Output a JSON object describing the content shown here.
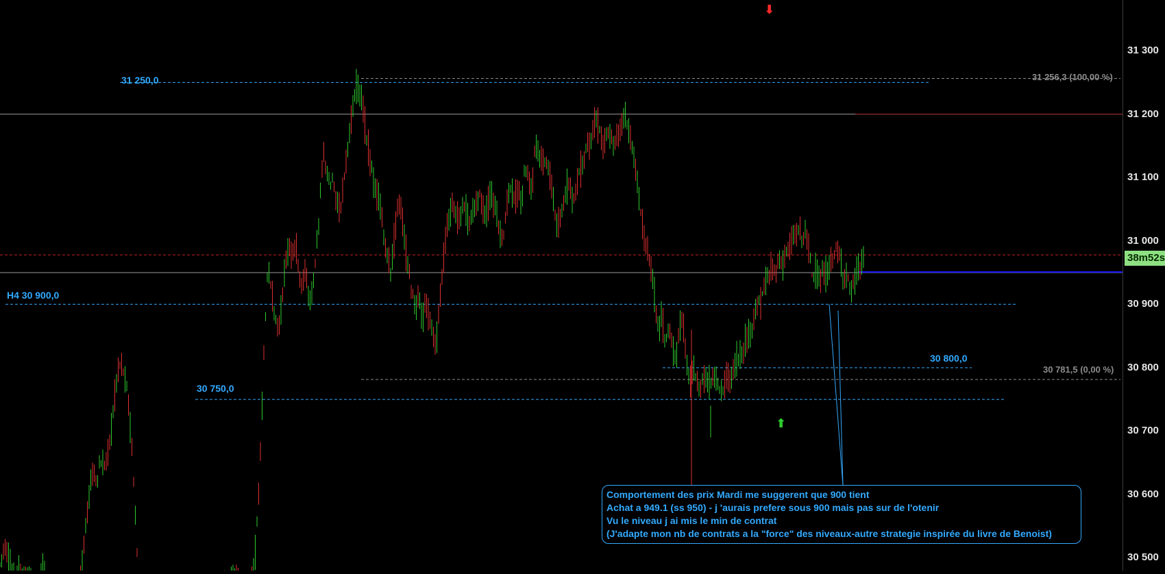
{
  "chart_data": {
    "type": "candlestick",
    "ylim": [
      30480,
      31380
    ],
    "ticks": [
      {
        "value": 31300,
        "label": "31 300"
      },
      {
        "value": 31200,
        "label": "31 200"
      },
      {
        "value": 31100,
        "label": "31 100"
      },
      {
        "value": 31000,
        "label": "31 000"
      },
      {
        "value": 30900,
        "label": "30 900"
      },
      {
        "value": 30800,
        "label": "30 800"
      },
      {
        "value": 30700,
        "label": "30 700"
      },
      {
        "value": 30600,
        "label": "30 600"
      },
      {
        "value": 30500,
        "label": "30 500"
      }
    ],
    "levels": [
      {
        "price": 31250.0,
        "label": "31 250,0"
      },
      {
        "price": 30900.0,
        "label": "H4 30 900,0"
      },
      {
        "price": 30800.0,
        "label": "30 800,0"
      },
      {
        "price": 30750.0,
        "label": "30 750,0"
      }
    ],
    "fibonacci": [
      {
        "price": 31256.3,
        "label": "31 256,3 (100,00 %)"
      },
      {
        "price": 30781.5,
        "label": "30 781,5 (0,00 %)"
      }
    ],
    "horizontal_lines": [
      31200,
      30950
    ],
    "current_price_line": 30978,
    "entry_line": 30951,
    "timer": "38m52s",
    "annotation": [
      "Comportement des prix Mardi me suggerent que 900 tient",
      "Achat a 949.1 (ss 950) - j 'aurais prefere sous 900 mais pas sur de l'otenir",
      "Vu le niveau j ai mis le min de contrat",
      "(J'adapte mon nb de contrats a la \"force\" des niveaux-autre strategie inspirée du livre de Benoist)"
    ],
    "colors": {
      "up": "#2ecc2e",
      "down": "#e03030",
      "level": "#33aaff",
      "fib": "#8c8c8c",
      "current": "#cc2222",
      "entry": "#1a1aff",
      "hline": "#9a9a9a",
      "background": "#000000"
    },
    "path": [
      [
        0,
        30490
      ],
      [
        6,
        30520
      ],
      [
        12,
        30505
      ],
      [
        16,
        30480
      ],
      [
        22,
        30465
      ],
      [
        26,
        30490
      ],
      [
        31,
        30470
      ],
      [
        36,
        30460
      ],
      [
        41,
        30475
      ],
      [
        46,
        30455
      ],
      [
        51,
        30445
      ],
      [
        56,
        30460
      ],
      [
        61,
        30480
      ],
      [
        66,
        30470
      ],
      [
        71,
        30440
      ],
      [
        76,
        30420
      ],
      [
        81,
        30400
      ],
      [
        86,
        30380
      ],
      [
        91,
        30390
      ],
      [
        96,
        30370
      ],
      [
        101,
        30380
      ],
      [
        106,
        30400
      ],
      [
        111,
        30420
      ],
      [
        116,
        30460
      ],
      [
        121,
        30500
      ],
      [
        126,
        30560
      ],
      [
        131,
        30610
      ],
      [
        136,
        30640
      ],
      [
        141,
        30620
      ],
      [
        146,
        30650
      ],
      [
        151,
        30640
      ],
      [
        156,
        30660
      ],
      [
        161,
        30690
      ],
      [
        166,
        30740
      ],
      [
        171,
        30790
      ],
      [
        176,
        30810
      ],
      [
        181,
        30790
      ],
      [
        186,
        30760
      ],
      [
        191,
        30700
      ],
      [
        196,
        30600
      ],
      [
        201,
        30480
      ],
      [
        206,
        30400
      ],
      [
        211,
        30350
      ],
      [
        216,
        30320
      ],
      [
        221,
        30300
      ],
      [
        226,
        30310
      ],
      [
        231,
        30290
      ],
      [
        236,
        30300
      ],
      [
        241,
        30280
      ],
      [
        246,
        30300
      ],
      [
        251,
        30290
      ],
      [
        256,
        30310
      ],
      [
        261,
        30300
      ],
      [
        266,
        30320
      ],
      [
        271,
        30310
      ],
      [
        276,
        30330
      ],
      [
        281,
        30340
      ],
      [
        286,
        30330
      ],
      [
        291,
        30340
      ],
      [
        296,
        30360
      ],
      [
        301,
        30350
      ],
      [
        306,
        30370
      ],
      [
        311,
        30380
      ],
      [
        316,
        30400
      ],
      [
        321,
        30420
      ],
      [
        326,
        30440
      ],
      [
        331,
        30460
      ],
      [
        336,
        30470
      ],
      [
        341,
        30480
      ],
      [
        346,
        30470
      ],
      [
        351,
        30450
      ],
      [
        356,
        30460
      ],
      [
        361,
        30440
      ],
      [
        366,
        30460
      ],
      [
        371,
        30480
      ],
      [
        376,
        30570
      ],
      [
        381,
        30700
      ],
      [
        386,
        30850
      ],
      [
        391,
        30960
      ],
      [
        396,
        30920
      ],
      [
        401,
        30880
      ],
      [
        406,
        30860
      ],
      [
        411,
        30900
      ],
      [
        416,
        30960
      ],
      [
        421,
        30990
      ],
      [
        426,
        30970
      ],
      [
        431,
        31000
      ],
      [
        436,
        30950
      ],
      [
        441,
        30930
      ],
      [
        446,
        30960
      ],
      [
        451,
        30900
      ],
      [
        456,
        30920
      ],
      [
        461,
        30980
      ],
      [
        466,
        31040
      ],
      [
        471,
        31140
      ],
      [
        476,
        31120
      ],
      [
        481,
        31080
      ],
      [
        486,
        31100
      ],
      [
        491,
        31060
      ],
      [
        496,
        31050
      ],
      [
        501,
        31090
      ],
      [
        506,
        31140
      ],
      [
        511,
        31180
      ],
      [
        516,
        31210
      ],
      [
        521,
        31250
      ],
      [
        526,
        31230
      ],
      [
        531,
        31200
      ],
      [
        536,
        31150
      ],
      [
        541,
        31130
      ],
      [
        546,
        31080
      ],
      [
        551,
        31070
      ],
      [
        556,
        31050
      ],
      [
        561,
        31000
      ],
      [
        566,
        30970
      ],
      [
        571,
        30950
      ],
      [
        576,
        31020
      ],
      [
        581,
        31060
      ],
      [
        586,
        31050
      ],
      [
        591,
        30990
      ],
      [
        596,
        30960
      ],
      [
        601,
        30920
      ],
      [
        606,
        30890
      ],
      [
        611,
        30920
      ],
      [
        616,
        30870
      ],
      [
        621,
        30900
      ],
      [
        626,
        30880
      ],
      [
        631,
        30860
      ],
      [
        636,
        30830
      ],
      [
        641,
        30900
      ],
      [
        646,
        30960
      ],
      [
        651,
        31010
      ],
      [
        656,
        31040
      ],
      [
        661,
        31060
      ],
      [
        666,
        31040
      ],
      [
        671,
        31030
      ],
      [
        676,
        31060
      ],
      [
        681,
        31040
      ],
      [
        686,
        31030
      ],
      [
        691,
        31050
      ],
      [
        696,
        31060
      ],
      [
        701,
        31080
      ],
      [
        706,
        31040
      ],
      [
        711,
        31050
      ],
      [
        716,
        31070
      ],
      [
        721,
        31060
      ],
      [
        726,
        31030
      ],
      [
        731,
        31000
      ],
      [
        736,
        31020
      ],
      [
        741,
        31070
      ],
      [
        746,
        31090
      ],
      [
        751,
        31060
      ],
      [
        756,
        31080
      ],
      [
        761,
        31060
      ],
      [
        766,
        31120
      ],
      [
        771,
        31100
      ],
      [
        776,
        31080
      ],
      [
        781,
        31160
      ],
      [
        786,
        31140
      ],
      [
        791,
        31120
      ],
      [
        796,
        31130
      ],
      [
        801,
        31110
      ],
      [
        806,
        31080
      ],
      [
        811,
        31030
      ],
      [
        816,
        31020
      ],
      [
        821,
        31050
      ],
      [
        826,
        31080
      ],
      [
        831,
        31100
      ],
      [
        836,
        31060
      ],
      [
        841,
        31090
      ],
      [
        846,
        31110
      ],
      [
        851,
        31120
      ],
      [
        856,
        31150
      ],
      [
        861,
        31160
      ],
      [
        866,
        31180
      ],
      [
        871,
        31190
      ],
      [
        876,
        31170
      ],
      [
        881,
        31150
      ],
      [
        886,
        31170
      ],
      [
        891,
        31160
      ],
      [
        896,
        31150
      ],
      [
        901,
        31170
      ],
      [
        906,
        31180
      ],
      [
        911,
        31200
      ],
      [
        916,
        31180
      ],
      [
        921,
        31160
      ],
      [
        926,
        31120
      ],
      [
        931,
        31080
      ],
      [
        936,
        31040
      ],
      [
        941,
        31000
      ],
      [
        946,
        30980
      ],
      [
        951,
        30960
      ],
      [
        956,
        30900
      ],
      [
        961,
        30860
      ],
      [
        966,
        30880
      ],
      [
        971,
        30840
      ],
      [
        976,
        30860
      ],
      [
        981,
        30830
      ],
      [
        986,
        30810
      ],
      [
        991,
        30860
      ],
      [
        996,
        30880
      ],
      [
        1001,
        30820
      ],
      [
        1006,
        30770
      ],
      [
        1011,
        30800
      ],
      [
        1016,
        30780
      ],
      [
        1021,
        30760
      ],
      [
        1026,
        30790
      ],
      [
        1031,
        30780
      ],
      [
        1036,
        30770
      ],
      [
        1041,
        30790
      ],
      [
        1046,
        30780
      ],
      [
        1051,
        30760
      ],
      [
        1056,
        30770
      ],
      [
        1061,
        30790
      ],
      [
        1066,
        30780
      ],
      [
        1071,
        30800
      ],
      [
        1076,
        30810
      ],
      [
        1081,
        30820
      ],
      [
        1086,
        30830
      ],
      [
        1091,
        30850
      ],
      [
        1096,
        30860
      ],
      [
        1101,
        30880
      ],
      [
        1106,
        30900
      ],
      [
        1111,
        30910
      ],
      [
        1116,
        30930
      ],
      [
        1121,
        30940
      ],
      [
        1126,
        30960
      ],
      [
        1131,
        30950
      ],
      [
        1136,
        30970
      ],
      [
        1141,
        30960
      ],
      [
        1146,
        30980
      ],
      [
        1151,
        30990
      ],
      [
        1156,
        31000
      ],
      [
        1161,
        31010
      ],
      [
        1166,
        31020
      ],
      [
        1171,
        31000
      ],
      [
        1176,
        31020
      ],
      [
        1181,
        30980
      ],
      [
        1186,
        30940
      ],
      [
        1191,
        30960
      ],
      [
        1196,
        30930
      ],
      [
        1201,
        30950
      ],
      [
        1206,
        30940
      ],
      [
        1211,
        30960
      ],
      [
        1216,
        30980
      ],
      [
        1221,
        30990
      ],
      [
        1226,
        30970
      ],
      [
        1231,
        30940
      ],
      [
        1236,
        30950
      ],
      [
        1241,
        30920
      ],
      [
        1246,
        30930
      ],
      [
        1251,
        30950
      ],
      [
        1256,
        30960
      ],
      [
        1261,
        30975
      ]
    ]
  }
}
